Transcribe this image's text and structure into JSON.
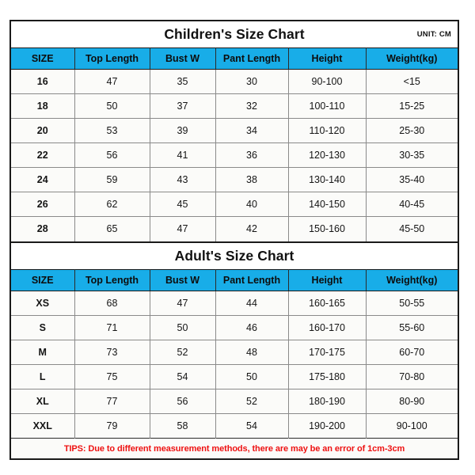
{
  "document": {
    "unit_label": "UNIT: CM",
    "accent_color": "#18ADE8",
    "tips_color": "#EE1111",
    "border_color": "#1A1A1A"
  },
  "children_chart": {
    "title": "Children's Size Chart",
    "unit": "UNIT: CM",
    "columns": [
      "SIZE",
      "Top Length",
      "Bust W",
      "Pant Length",
      "Height",
      "Weight(kg)"
    ],
    "rows": [
      {
        "size": "16",
        "top_length": "47",
        "bust_w": "35",
        "pant_length": "30",
        "height": "90-100",
        "weight": "<15"
      },
      {
        "size": "18",
        "top_length": "50",
        "bust_w": "37",
        "pant_length": "32",
        "height": "100-110",
        "weight": "15-25"
      },
      {
        "size": "20",
        "top_length": "53",
        "bust_w": "39",
        "pant_length": "34",
        "height": "110-120",
        "weight": "25-30"
      },
      {
        "size": "22",
        "top_length": "56",
        "bust_w": "41",
        "pant_length": "36",
        "height": "120-130",
        "weight": "30-35"
      },
      {
        "size": "24",
        "top_length": "59",
        "bust_w": "43",
        "pant_length": "38",
        "height": "130-140",
        "weight": "35-40"
      },
      {
        "size": "26",
        "top_length": "62",
        "bust_w": "45",
        "pant_length": "40",
        "height": "140-150",
        "weight": "40-45"
      },
      {
        "size": "28",
        "top_length": "65",
        "bust_w": "47",
        "pant_length": "42",
        "height": "150-160",
        "weight": "45-50"
      }
    ]
  },
  "adult_chart": {
    "title": "Adult's Size Chart",
    "columns": [
      "SIZE",
      "Top Length",
      "Bust W",
      "Pant Length",
      "Height",
      "Weight(kg)"
    ],
    "rows": [
      {
        "size": "XS",
        "top_length": "68",
        "bust_w": "47",
        "pant_length": "44",
        "height": "160-165",
        "weight": "50-55"
      },
      {
        "size": "S",
        "top_length": "71",
        "bust_w": "50",
        "pant_length": "46",
        "height": "160-170",
        "weight": "55-60"
      },
      {
        "size": "M",
        "top_length": "73",
        "bust_w": "52",
        "pant_length": "48",
        "height": "170-175",
        "weight": "60-70"
      },
      {
        "size": "L",
        "top_length": "75",
        "bust_w": "54",
        "pant_length": "50",
        "height": "175-180",
        "weight": "70-80"
      },
      {
        "size": "XL",
        "top_length": "77",
        "bust_w": "56",
        "pant_length": "52",
        "height": "180-190",
        "weight": "80-90"
      },
      {
        "size": "XXL",
        "top_length": "79",
        "bust_w": "58",
        "pant_length": "54",
        "height": "190-200",
        "weight": "90-100"
      }
    ]
  },
  "footer": {
    "tips": "TIPS: Due to different measurement methods, there are may be an error of 1cm-3cm"
  }
}
